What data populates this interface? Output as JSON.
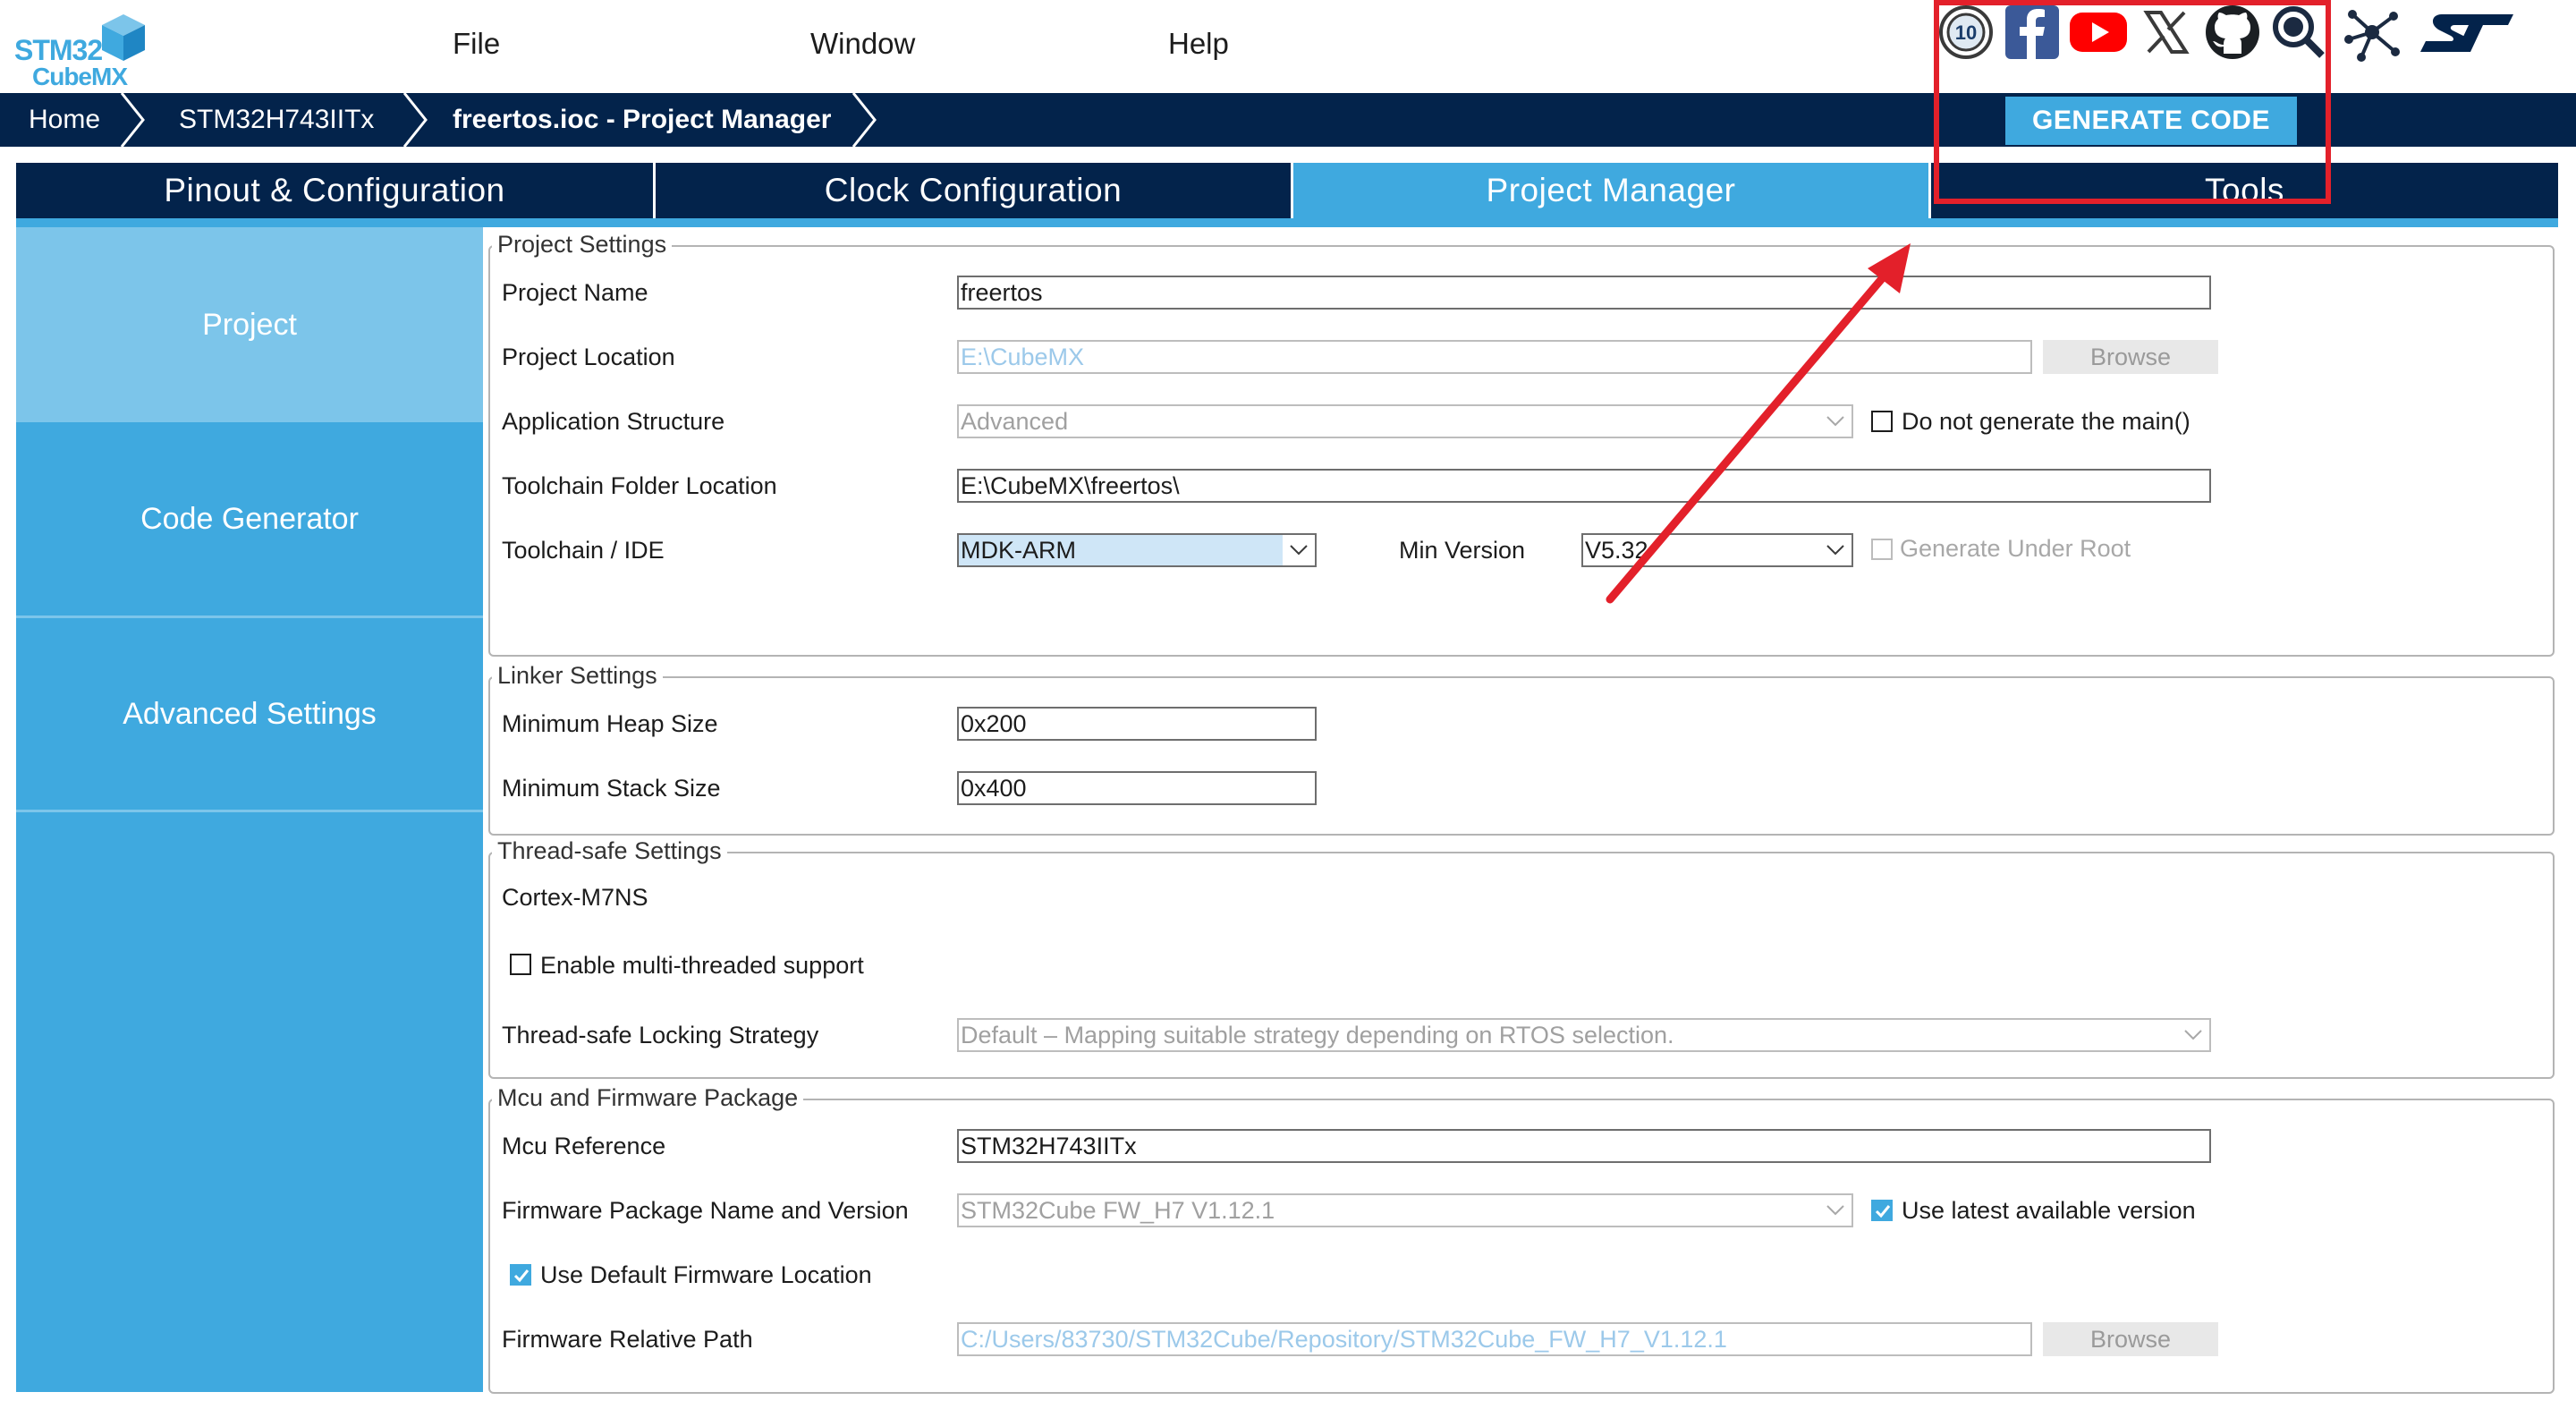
{
  "app": {
    "logo_line1": "STM32",
    "logo_line2": "CubeMX"
  },
  "menu": {
    "items": [
      "File",
      "Window",
      "Help"
    ]
  },
  "social_icons": [
    "tenth-anniversary-icon",
    "facebook-icon",
    "youtube-icon",
    "x-icon",
    "github-icon",
    "community-search-icon",
    "network-icon",
    "st-logo-icon"
  ],
  "breadcrumb": {
    "items": [
      "Home",
      "STM32H743IITx",
      "freertos.ioc - Project Manager"
    ]
  },
  "generate_button": "GENERATE CODE",
  "tabs": [
    {
      "label": "Pinout & Configuration",
      "active": false
    },
    {
      "label": "Clock Configuration",
      "active": false
    },
    {
      "label": "Project Manager",
      "active": true
    },
    {
      "label": "Tools",
      "active": false
    }
  ],
  "sidebar": {
    "items": [
      {
        "label": "Project",
        "active": true
      },
      {
        "label": "Code Generator",
        "active": false
      },
      {
        "label": "Advanced Settings",
        "active": false
      }
    ]
  },
  "project_settings": {
    "title": "Project Settings",
    "project_name_label": "Project Name",
    "project_name": "freertos",
    "project_location_label": "Project Location",
    "project_location": "E:\\CubeMX",
    "browse": "Browse",
    "app_structure_label": "Application Structure",
    "app_structure": "Advanced",
    "no_main_label": "Do not generate the main()",
    "no_main_checked": false,
    "toolchain_folder_label": "Toolchain Folder Location",
    "toolchain_folder": "E:\\CubeMX\\freertos\\",
    "toolchain_label": "Toolchain / IDE",
    "toolchain": "MDK-ARM",
    "min_version_label": "Min Version",
    "min_version": "V5.32",
    "gen_under_root_label": "Generate Under Root",
    "gen_under_root_checked": false
  },
  "linker_settings": {
    "title": "Linker Settings",
    "heap_label": "Minimum Heap Size",
    "heap": "0x200",
    "stack_label": "Minimum Stack Size",
    "stack": "0x400"
  },
  "thread_safe": {
    "title": "Thread-safe Settings",
    "core": "Cortex-M7NS",
    "multithread_label": "Enable multi-threaded support",
    "multithread_checked": false,
    "locking_label": "Thread-safe Locking Strategy",
    "locking": "Default – Mapping suitable strategy depending on RTOS selection."
  },
  "mcu_firmware": {
    "title": "Mcu and Firmware Package",
    "mcu_ref_label": "Mcu Reference",
    "mcu_ref": "STM32H743IITx",
    "fw_pkg_label": "Firmware Package Name and Version",
    "fw_pkg": "STM32Cube FW_H7 V1.12.1",
    "use_latest_label": "Use latest available version",
    "use_latest_checked": true,
    "default_loc_label": "Use Default Firmware Location",
    "default_loc_checked": true,
    "rel_path_label": "Firmware Relative Path",
    "rel_path": "C:/Users/83730/STM32Cube/Repository/STM32Cube_FW_H7_V1.12.1",
    "browse": "Browse"
  },
  "colors": {
    "navy": "#03234b",
    "accent": "#3fa9df",
    "sidebar_active": "#7cc5ea",
    "annotation": "#e3202a"
  }
}
